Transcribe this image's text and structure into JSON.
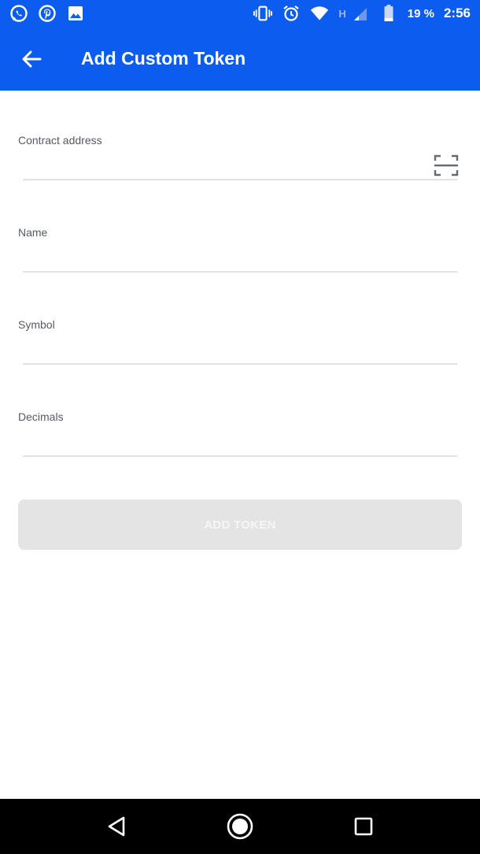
{
  "status_bar": {
    "battery_text": "19 %",
    "time": "2:56",
    "network_type": "H"
  },
  "app_bar": {
    "title": "Add Custom Token",
    "back_icon": "arrow-left-icon",
    "background_color": "#0c5cf0"
  },
  "form": {
    "fields": [
      {
        "label": "Contract address",
        "value": "",
        "placeholder": ""
      },
      {
        "label": "Name",
        "value": "",
        "placeholder": ""
      },
      {
        "label": "Symbol",
        "value": "",
        "placeholder": ""
      },
      {
        "label": "Decimals",
        "value": "",
        "placeholder": ""
      }
    ],
    "scan_icon": "qr-scan-icon",
    "submit_label": "ADD TOKEN",
    "submit_disabled": true
  }
}
